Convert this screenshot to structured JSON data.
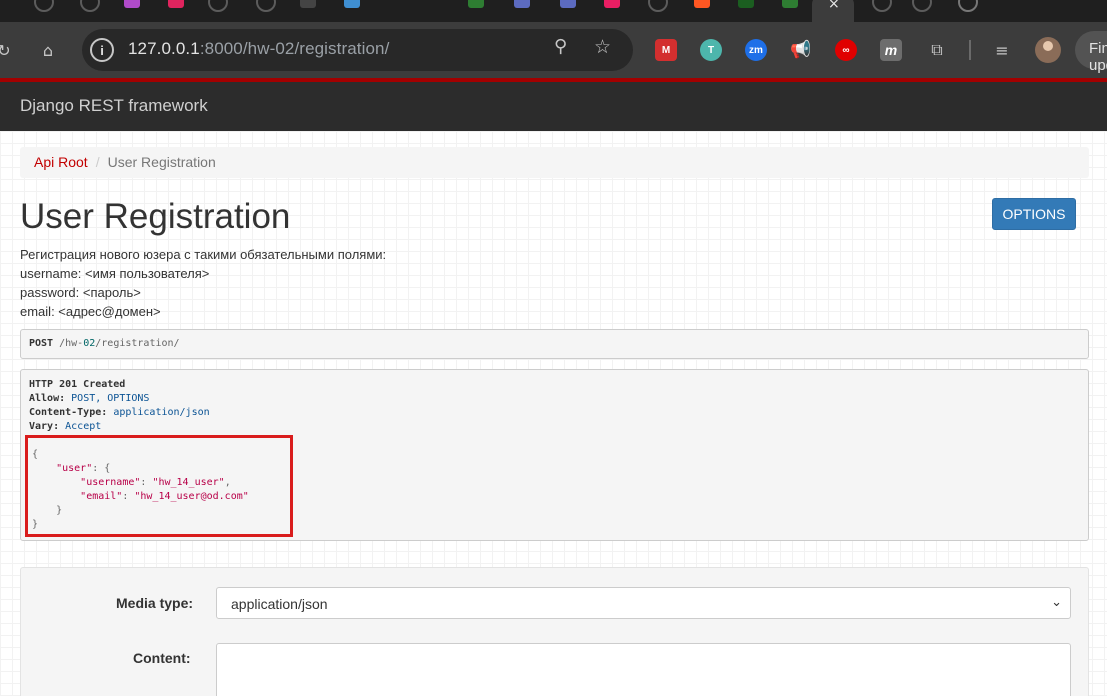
{
  "browser": {
    "url_host": "127.0.0.1",
    "url_rest": ":8000/hw-02/registration/",
    "profile_button": "Finish update",
    "extensions": [
      {
        "name": "mendeley-extension",
        "label": "M",
        "color": "#d32f2f"
      },
      {
        "name": "t-extension",
        "label": "T",
        "color": "#4db6ac"
      },
      {
        "name": "zoom-extension",
        "label": "zm",
        "color": "#1e6fe8"
      },
      {
        "name": "megaphone-extension",
        "label": "",
        "color": "#e65100"
      },
      {
        "name": "infinity-extension",
        "label": "∞",
        "color": "#e00000"
      },
      {
        "name": "m-extension",
        "label": "m",
        "color": "#6d6d6d"
      }
    ]
  },
  "navbar": {
    "brand": "Django REST framework"
  },
  "breadcrumb": {
    "root": "Api Root",
    "separator": "/",
    "current": "User Registration"
  },
  "page": {
    "title": "User Registration",
    "options_label": "OPTIONS",
    "description": [
      "Регистрация нового юзера с такими обязательными полями:",
      "username: <имя пользователя>",
      "password: <пароль>",
      "email: <адрес@домен>"
    ]
  },
  "request": {
    "method": "POST",
    "path_pre": "/hw-",
    "path_num": "02",
    "path_post": "/registration/"
  },
  "response": {
    "status": "HTTP 201 Created",
    "headers": [
      {
        "name": "Allow:",
        "value": "POST, OPTIONS"
      },
      {
        "name": "Content-Type:",
        "value": "application/json"
      },
      {
        "name": "Vary:",
        "value": "Accept"
      }
    ],
    "body": {
      "open": "{",
      "user_key": "\"user\"",
      "username_key": "\"username\"",
      "username_value": "\"hw_14_user\"",
      "email_key": "\"email\"",
      "email_value": "\"hw_14_user@od.com\"",
      "inner_close": "}",
      "close": "}"
    }
  },
  "form": {
    "media_type_label": "Media type:",
    "media_type_value": "application/json",
    "content_label": "Content:"
  }
}
